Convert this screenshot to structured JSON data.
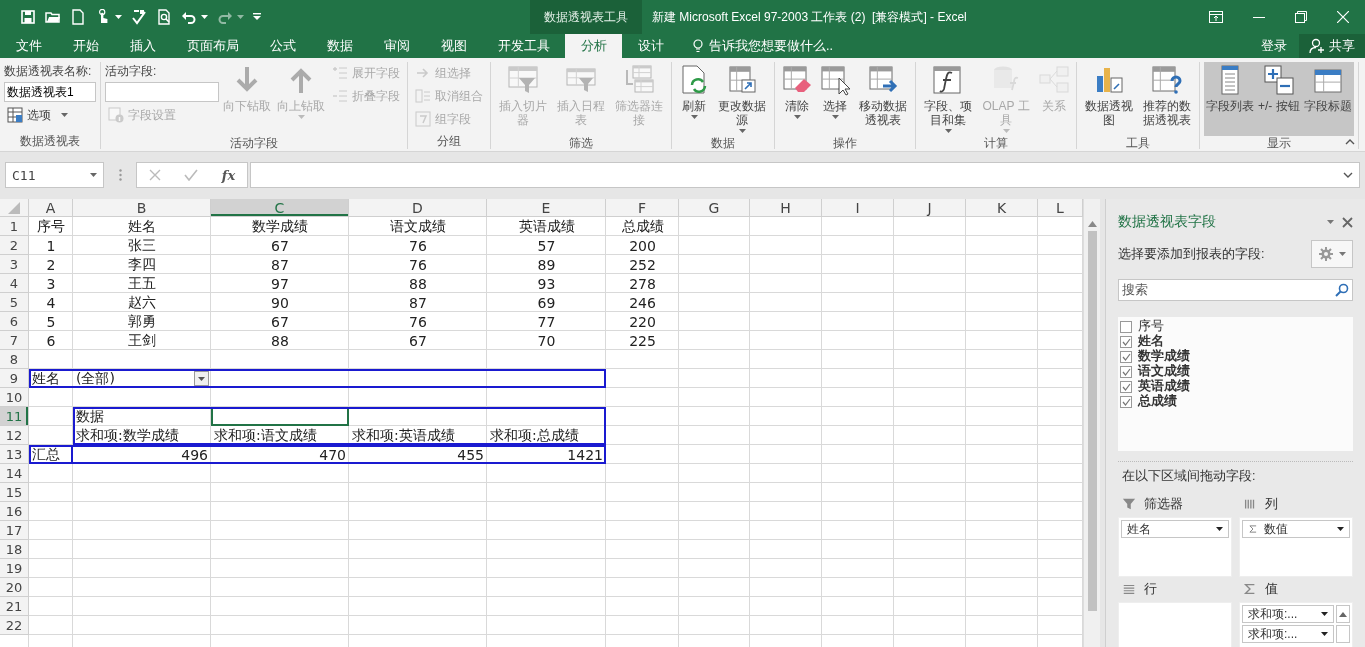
{
  "window": {
    "context_tab": "数据透视表工具",
    "title": "新建 Microsoft Excel 97-2003 工作表 (2)  [兼容模式] - Excel"
  },
  "quick_access_toolbar": [
    {
      "disabled": false,
      "has_menu": false
    },
    {
      "disabled": false,
      "has_menu": false
    },
    {
      "disabled": false,
      "has_menu": false
    },
    {
      "disabled": false,
      "has_menu": true
    },
    {
      "disabled": false,
      "has_menu": false
    },
    {
      "disabled": false,
      "has_menu": false
    },
    {
      "disabled": false,
      "has_menu": true
    },
    {
      "disabled": true,
      "has_menu": true
    }
  ],
  "ribbon_tabs": [
    {
      "label": "文件",
      "selected": false
    },
    {
      "label": "开始",
      "selected": false
    },
    {
      "label": "插入",
      "selected": false
    },
    {
      "label": "页面布局",
      "selected": false
    },
    {
      "label": "公式",
      "selected": false
    },
    {
      "label": "数据",
      "selected": false
    },
    {
      "label": "审阅",
      "selected": false
    },
    {
      "label": "视图",
      "selected": false
    },
    {
      "label": "开发工具",
      "selected": false
    },
    {
      "label": "分析",
      "selected": true
    },
    {
      "label": "设计",
      "selected": false
    }
  ],
  "tell_me": {
    "placeholder": "告诉我您想要做什么.."
  },
  "account": {
    "sign_in": "登录",
    "share": "共享"
  },
  "ribbon_groups": [
    {
      "label": "数据透视表",
      "items": [
        {
          "kind": "caption",
          "text": "数据透视表名称:"
        },
        {
          "kind": "field",
          "value": "数据透视表1"
        },
        {
          "kind": "small",
          "label": "选项",
          "disabled": false,
          "has_menu": true
        }
      ]
    },
    {
      "label": "活动字段",
      "items": [
        {
          "kind": "caption",
          "text": "活动字段:"
        },
        {
          "kind": "field"
        },
        {
          "kind": "small",
          "label": "字段设置",
          "disabled": true,
          "has_menu": false
        },
        {
          "kind": "large",
          "label": "向下钻取",
          "disabled": true,
          "has_menu": false
        },
        {
          "kind": "large",
          "label": "向上钻取",
          "disabled": true,
          "has_menu": true
        },
        {
          "kind": "small",
          "label": "展开字段",
          "disabled": true,
          "has_menu": false
        },
        {
          "kind": "small",
          "label": "折叠字段",
          "disabled": true,
          "has_menu": false
        }
      ]
    },
    {
      "label": "分组",
      "items": [
        {
          "kind": "small",
          "label": "组选择",
          "disabled": true,
          "has_menu": false
        },
        {
          "kind": "small",
          "label": "取消组合",
          "disabled": true,
          "has_menu": false
        },
        {
          "kind": "small",
          "label": "组字段",
          "disabled": true,
          "has_menu": false
        }
      ]
    },
    {
      "label": "筛选",
      "items": [
        {
          "kind": "large",
          "label": "插入切片器",
          "disabled": true,
          "has_menu": false
        },
        {
          "kind": "large",
          "label": "插入日程表",
          "disabled": true,
          "has_menu": false
        },
        {
          "kind": "large",
          "label": "筛选器连接",
          "disabled": true,
          "has_menu": false
        }
      ]
    },
    {
      "label": "数据",
      "items": [
        {
          "kind": "large",
          "label": "刷新",
          "disabled": false,
          "has_menu": true
        },
        {
          "kind": "large",
          "label": "更改数据源",
          "disabled": false,
          "has_menu": true
        }
      ]
    },
    {
      "label": "操作",
      "items": [
        {
          "kind": "large",
          "label": "清除",
          "disabled": false,
          "has_menu": true
        },
        {
          "kind": "large",
          "label": "选择",
          "disabled": false,
          "has_menu": true
        },
        {
          "kind": "large",
          "label": "移动数据透视表",
          "disabled": false,
          "has_menu": false
        }
      ]
    },
    {
      "label": "计算",
      "items": [
        {
          "kind": "large",
          "label": "字段、项目和集",
          "disabled": false,
          "has_menu": true
        },
        {
          "kind": "large",
          "label": "OLAP 工具",
          "disabled": true,
          "has_menu": true
        },
        {
          "kind": "large",
          "label": "关系",
          "disabled": true,
          "has_menu": false
        }
      ]
    },
    {
      "label": "工具",
      "items": [
        {
          "kind": "large",
          "label": "数据透视图",
          "disabled": false,
          "has_menu": false
        },
        {
          "kind": "large",
          "label": "推荐的数据透视表",
          "disabled": false,
          "has_menu": false
        }
      ]
    },
    {
      "label": "显示",
      "items": [
        {
          "kind": "large",
          "label": "字段列表",
          "disabled": false,
          "has_menu": false,
          "on": true
        },
        {
          "kind": "large",
          "label": "+/- 按钮",
          "disabled": false,
          "has_menu": false,
          "on": true
        },
        {
          "kind": "large",
          "label": "字段标题",
          "disabled": false,
          "has_menu": false,
          "on": true
        }
      ]
    }
  ],
  "formula_bar": {
    "name_box": "C11",
    "function_button": "fx"
  },
  "sheet": {
    "columns": [
      {
        "label": "A",
        "selected": false
      },
      {
        "label": "B",
        "selected": false
      },
      {
        "label": "C",
        "selected": true
      },
      {
        "label": "D",
        "selected": false
      },
      {
        "label": "E",
        "selected": false
      },
      {
        "label": "F",
        "selected": false
      },
      {
        "label": "G",
        "selected": false
      },
      {
        "label": "H",
        "selected": false
      },
      {
        "label": "I",
        "selected": false
      },
      {
        "label": "J",
        "selected": false
      },
      {
        "label": "K",
        "selected": false
      },
      {
        "label": "L",
        "selected": false
      }
    ],
    "rows": [
      {
        "label": "1",
        "selected": false,
        "kind": "table",
        "cells": [
          "序号",
          "姓名",
          "数学成绩",
          "语文成绩",
          "英语成绩",
          "总成绩"
        ]
      },
      {
        "label": "2",
        "selected": false,
        "kind": "table",
        "cells": [
          "1",
          "张三",
          "67",
          "76",
          "57",
          "200"
        ]
      },
      {
        "label": "3",
        "selected": false,
        "kind": "table",
        "cells": [
          "2",
          "李四",
          "87",
          "76",
          "89",
          "252"
        ]
      },
      {
        "label": "4",
        "selected": false,
        "kind": "table",
        "cells": [
          "3",
          "王五",
          "97",
          "88",
          "93",
          "278"
        ]
      },
      {
        "label": "5",
        "selected": false,
        "kind": "table",
        "cells": [
          "4",
          "赵六",
          "90",
          "87",
          "69",
          "246"
        ]
      },
      {
        "label": "6",
        "selected": false,
        "kind": "table",
        "cells": [
          "5",
          "郭勇",
          "67",
          "76",
          "77",
          "220"
        ]
      },
      {
        "label": "7",
        "selected": false,
        "kind": "table",
        "cells": [
          "6",
          "王剑",
          "88",
          "67",
          "70",
          "225"
        ]
      },
      {
        "label": "8",
        "selected": false
      },
      {
        "label": "9",
        "selected": false,
        "kind": "pivot-filter",
        "cells": [
          "姓名",
          "(全部)"
        ]
      },
      {
        "label": "10",
        "selected": false
      },
      {
        "label": "11",
        "selected": true,
        "kind": "pivot-caption",
        "cells": [
          "数据"
        ]
      },
      {
        "label": "12",
        "selected": false,
        "kind": "pivot-header",
        "cells": [
          "求和项:数学成绩",
          "求和项:语文成绩",
          "求和项:英语成绩",
          "求和项:总成绩"
        ]
      },
      {
        "label": "13",
        "selected": false,
        "kind": "pivot-total",
        "cells": [
          "汇总",
          "496",
          "470",
          "455",
          "1421"
        ]
      },
      {
        "label": "14",
        "selected": false
      },
      {
        "label": "15",
        "selected": false
      },
      {
        "label": "16",
        "selected": false
      },
      {
        "label": "17",
        "selected": false
      },
      {
        "label": "18",
        "selected": false
      },
      {
        "label": "19",
        "selected": false
      },
      {
        "label": "20",
        "selected": false
      },
      {
        "label": "21",
        "selected": false
      },
      {
        "label": "22",
        "selected": false
      }
    ]
  },
  "field_list_pane": {
    "title": "数据透视表字段",
    "prompt": "选择要添加到报表的字段:",
    "search": {
      "placeholder": "搜索"
    },
    "fields": [
      {
        "label": "序号",
        "checked": false
      },
      {
        "label": "姓名",
        "checked": true
      },
      {
        "label": "数学成绩",
        "checked": true
      },
      {
        "label": "语文成绩",
        "checked": true
      },
      {
        "label": "英语成绩",
        "checked": true
      },
      {
        "label": "总成绩",
        "checked": true
      }
    ],
    "areas_prompt": "在以下区域间拖动字段:",
    "areas": [
      {
        "kind": "filters",
        "label": "筛选器",
        "items": [
          {
            "label": "姓名",
            "kind": "field"
          }
        ]
      },
      {
        "kind": "columns",
        "label": "列",
        "items": [
          {
            "label": "数值",
            "kind": "values"
          }
        ]
      },
      {
        "kind": "rows",
        "label": "行"
      },
      {
        "kind": "values",
        "label": "值",
        "items": [
          {
            "label": "求和项:...",
            "kind": "field"
          },
          {
            "label": "求和项:...",
            "kind": "field"
          }
        ]
      }
    ]
  }
}
